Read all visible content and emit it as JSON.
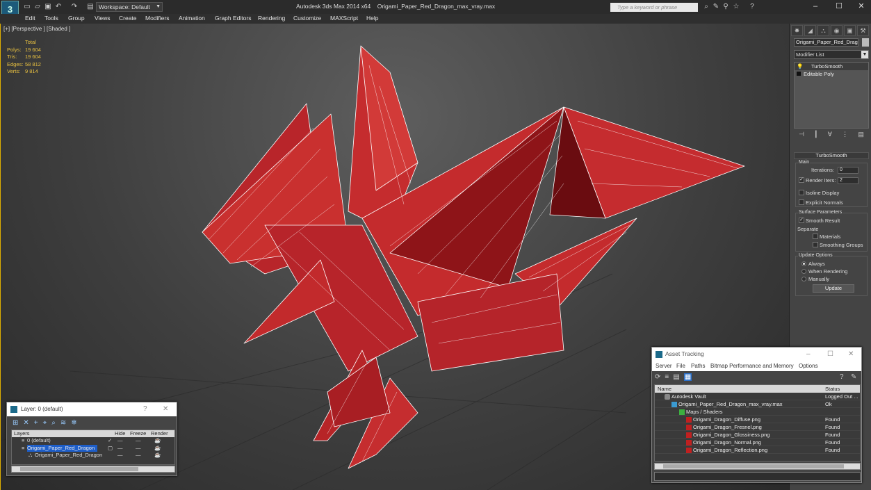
{
  "title_bar": {
    "app_title": "Autodesk 3ds Max 2014 x64",
    "file_name": "Origami_Paper_Red_Dragon_max_vray.max",
    "workspace_label": "Workspace: Default",
    "search_placeholder": "Type a keyword or phrase"
  },
  "menu": [
    "Edit",
    "Tools",
    "Group",
    "Views",
    "Create",
    "Modifiers",
    "Animation",
    "Graph Editors",
    "Rendering",
    "Customize",
    "MAXScript",
    "Help"
  ],
  "viewport": {
    "label": "[+] [Perspective ] [Shaded ]",
    "stats": {
      "header": "Total",
      "rows": [
        {
          "k": "Polys:",
          "v": "19 604"
        },
        {
          "k": "Tris:",
          "v": "19 604"
        },
        {
          "k": "Edges:",
          "v": "58 812"
        },
        {
          "k": "Verts:",
          "v": "9 814"
        }
      ]
    }
  },
  "command_panel": {
    "object_name": "Origami_Paper_Red_Dragon",
    "modifier_list": "Modifier List",
    "stack": [
      "TurboSmooth",
      "Editable Poly"
    ],
    "rollout_title": "TurboSmooth",
    "main_group": "Main",
    "iterations_label": "Iterations:",
    "iterations_value": "0",
    "render_iters_label": "Render Iters:",
    "render_iters_value": "2",
    "isoline_display": "Isoline Display",
    "explicit_normals": "Explicit Normals",
    "surface_group": "Surface Parameters",
    "smooth_result": "Smooth Result",
    "separate": "Separate",
    "materials": "Materials",
    "smoothing_groups": "Smoothing Groups",
    "update_group": "Update Options",
    "always": "Always",
    "when_rendering": "When Rendering",
    "manually": "Manually",
    "update_button": "Update"
  },
  "layer_dialog": {
    "title": "Layer: 0 (default)",
    "help": "?",
    "close": "✕",
    "columns": [
      "Layers",
      "Hide",
      "Freeze",
      "Render"
    ],
    "rows": [
      "0 (default)",
      "Origami_Paper_Red_Dragon",
      "Origami_Paper_Red_Dragon"
    ]
  },
  "asset_dialog": {
    "title": "Asset Tracking",
    "menu": [
      "Server",
      "File",
      "Paths",
      "Bitmap Performance and Memory",
      "Options"
    ],
    "columns": [
      "Name",
      "Status"
    ],
    "rows": [
      {
        "name": "Autodesk Vault",
        "status": "Logged Out ...",
        "indent": 0,
        "icon": "vault"
      },
      {
        "name": "Origami_Paper_Red_Dragon_max_vray.max",
        "status": "Ok",
        "indent": 1,
        "icon": "file"
      },
      {
        "name": "Maps / Shaders",
        "status": "",
        "indent": 2,
        "icon": "maps"
      },
      {
        "name": "Origami_Dragon_Diffuse.png",
        "status": "Found",
        "indent": 3,
        "icon": "image"
      },
      {
        "name": "Origami_Dragon_Fresnel.png",
        "status": "Found",
        "indent": 3,
        "icon": "image"
      },
      {
        "name": "Origami_Dragon_Glossiness.png",
        "status": "Found",
        "indent": 3,
        "icon": "image"
      },
      {
        "name": "Origami_Dragon_Normal.png",
        "status": "Found",
        "indent": 3,
        "icon": "image"
      },
      {
        "name": "Origami_Dragon_Reflection.png",
        "status": "Found",
        "indent": 3,
        "icon": "image"
      }
    ]
  },
  "colors": {
    "viewport_border": "#e0b000",
    "stats_text": "#e8c040",
    "dragon_fill": "#c0282c",
    "dragon_wire": "#ffffff",
    "selection": "#1e5ec8"
  }
}
